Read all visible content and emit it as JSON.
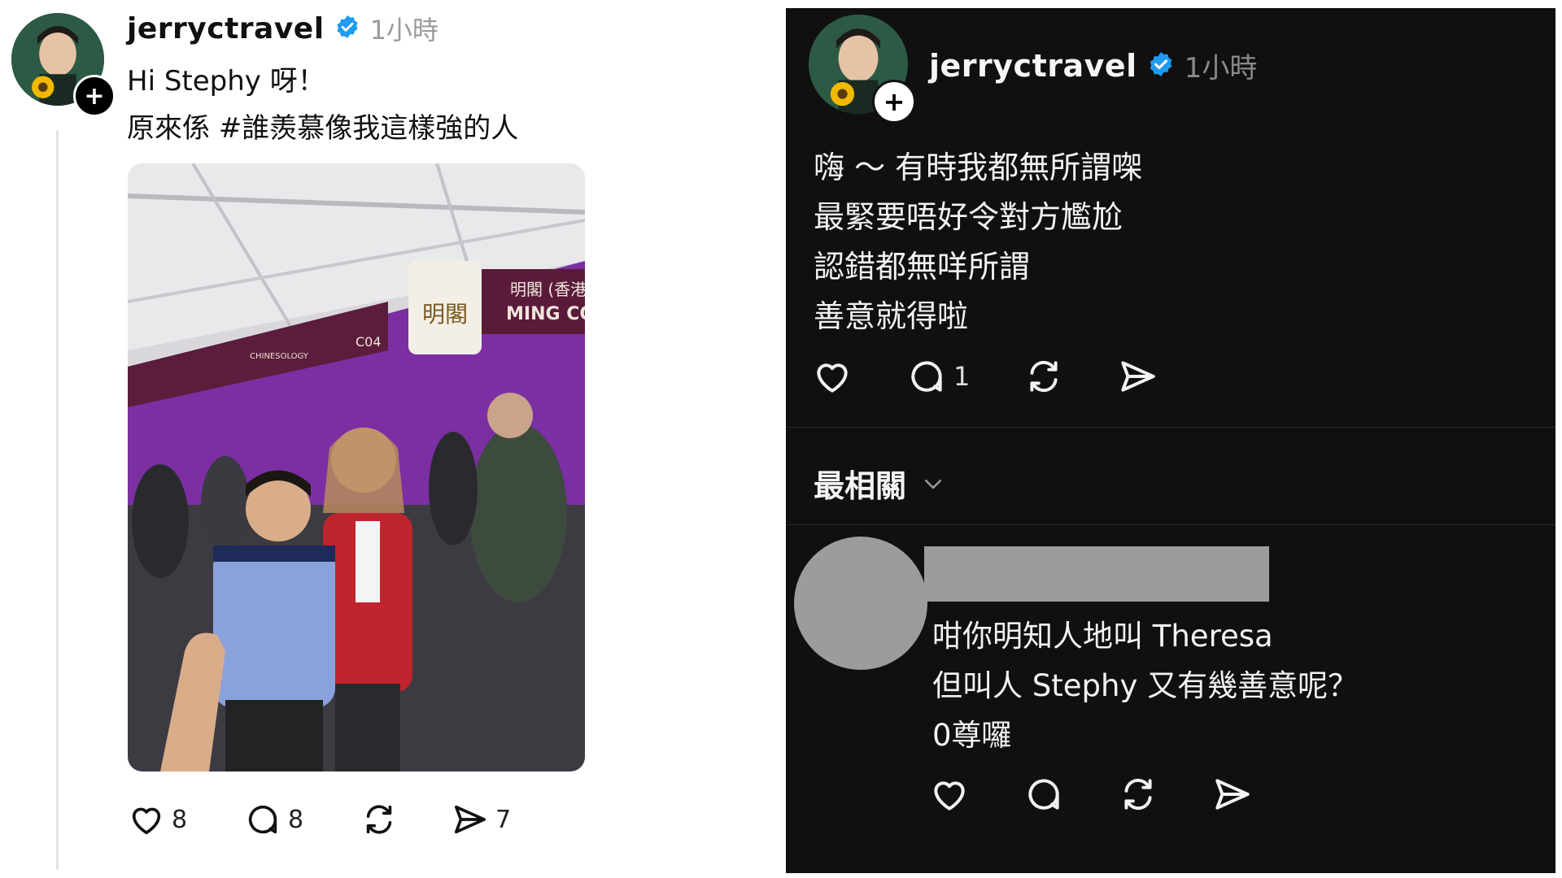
{
  "left_post": {
    "username": "jerryctravel",
    "verified_icon": "verified-badge-icon",
    "timestamp": "1小時",
    "line1": "Hi Stephy 呀！",
    "line2": "原來係 #誰羨慕像我這樣強的人",
    "photo": {
      "sign_chinese": "明閣",
      "sign_chinese2": "明閣 (香港",
      "sign_english": "MING CO",
      "booth_code": "C04",
      "booth_sub": "CHINESOLOGY"
    },
    "actions": {
      "like_icon": "heart-icon",
      "like_count": "8",
      "comment_icon": "comment-bubble-icon",
      "comment_count": "8",
      "repost_icon": "repost-icon",
      "share_icon": "send-icon",
      "share_count": "7"
    }
  },
  "right_post": {
    "username": "jerryctravel",
    "timestamp": "1小時",
    "lines": [
      "嗨 ～ 有時我都無所謂㗎",
      "最緊要唔好令對方尷尬",
      "認錯都無咩所謂",
      "善意就得啦"
    ],
    "actions": {
      "comment_count": "1"
    },
    "sort_label": "最相關",
    "sort_icon": "chevron-down-icon"
  },
  "reply": {
    "lines": [
      "咁你明知人地叫 Theresa",
      "但叫人 Stephy 又有幾善意呢？",
      "0尊囉"
    ]
  },
  "colors": {
    "verified_blue": "#1d9bf0",
    "dark_bg": "#101010",
    "redacted_gray": "#9c9c9c",
    "purple_booth": "#7b2fa3"
  }
}
